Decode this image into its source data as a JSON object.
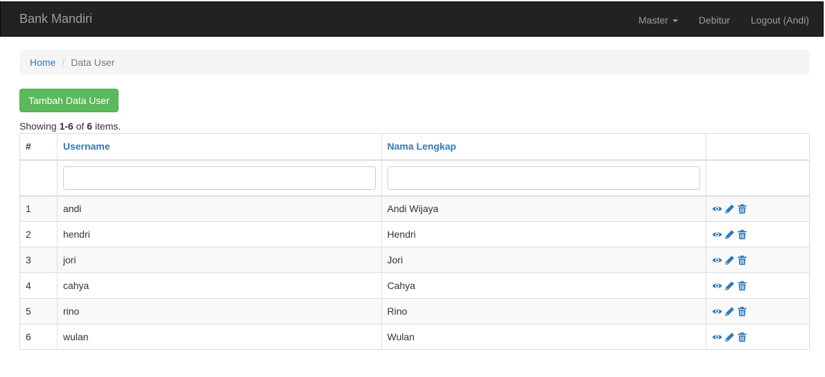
{
  "navbar": {
    "brand": "Bank Mandiri",
    "items": [
      {
        "label": "Master",
        "dropdown": true
      },
      {
        "label": "Debitur"
      },
      {
        "label": "Logout (Andi)"
      }
    ]
  },
  "breadcrumb": {
    "home": "Home",
    "separator": "/",
    "current": "Data User"
  },
  "toolbar": {
    "add_label": "Tambah Data User"
  },
  "summary": {
    "prefix": "Showing ",
    "range": "1-6",
    "mid": " of ",
    "total": "6",
    "suffix": " items."
  },
  "table": {
    "headers": {
      "index": "#",
      "username": "Username",
      "fullname": "Nama Lengkap"
    },
    "rows": [
      {
        "no": "1",
        "username": "andi",
        "fullname": "Andi Wijaya"
      },
      {
        "no": "2",
        "username": "hendri",
        "fullname": "Hendri"
      },
      {
        "no": "3",
        "username": "jori",
        "fullname": "Jori"
      },
      {
        "no": "4",
        "username": "cahya",
        "fullname": "Cahya"
      },
      {
        "no": "5",
        "username": "rino",
        "fullname": "Rino"
      },
      {
        "no": "6",
        "username": "wulan",
        "fullname": "Wulan"
      }
    ],
    "action_icons": [
      "eye-icon",
      "pencil-icon",
      "trash-icon"
    ]
  },
  "colors": {
    "navbar_bg": "#222222",
    "navbar_text": "#9d9d9d",
    "link": "#337ab7",
    "success": "#5cb85c",
    "stripe": "#f9f9f9",
    "border": "#dddddd"
  }
}
